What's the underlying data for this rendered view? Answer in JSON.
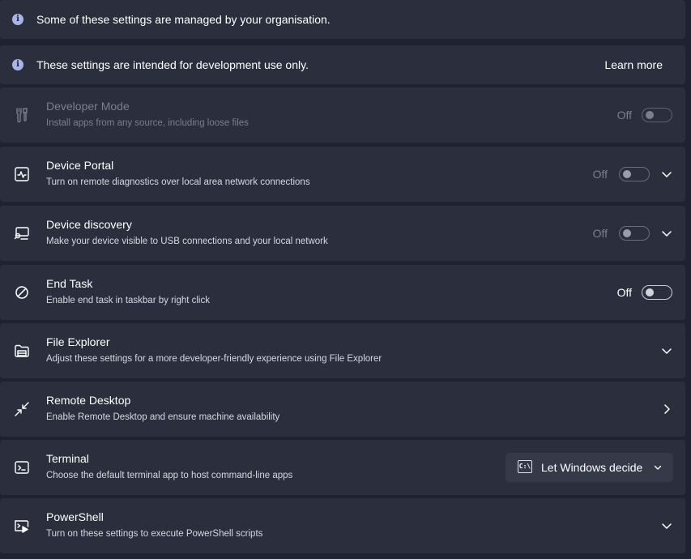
{
  "banners": [
    {
      "text": "Some of these settings are managed by your organisation."
    },
    {
      "text": "These settings are intended for development use only.",
      "link": "Learn more"
    }
  ],
  "items": {
    "developer_mode": {
      "title": "Developer Mode",
      "description": "Install apps from any source, including loose files",
      "toggle": "Off",
      "icon": "developer-tools-icon"
    },
    "device_portal": {
      "title": "Device Portal",
      "description": "Turn on remote diagnostics over local area network connections",
      "toggle": "Off",
      "icon": "device-portal-icon"
    },
    "device_discovery": {
      "title": "Device discovery",
      "description": "Make your device visible to USB connections and your local network",
      "toggle": "Off",
      "icon": "device-discovery-icon"
    },
    "end_task": {
      "title": "End Task",
      "description": "Enable end task in taskbar by right click",
      "toggle": "Off",
      "icon": "prohibited-icon"
    },
    "file_explorer": {
      "title": "File Explorer",
      "description": "Adjust these settings for a more developer-friendly experience using File Explorer",
      "icon": "folder-icon"
    },
    "remote_desktop": {
      "title": "Remote Desktop",
      "description": "Enable Remote Desktop and ensure machine availability",
      "icon": "remote-desktop-icon"
    },
    "terminal": {
      "title": "Terminal",
      "description": "Choose the default terminal app to host command-line apps",
      "dropdown_value": "Let Windows decide",
      "icon": "terminal-icon"
    },
    "powershell": {
      "title": "PowerShell",
      "description": "Turn on these settings to execute PowerShell scripts",
      "icon": "powershell-icon"
    }
  },
  "colors": {
    "background": "#1f2230",
    "card": "#2b2f3d",
    "info_icon": "#a9b4e8",
    "disabled_text": "#7b7f8c"
  }
}
